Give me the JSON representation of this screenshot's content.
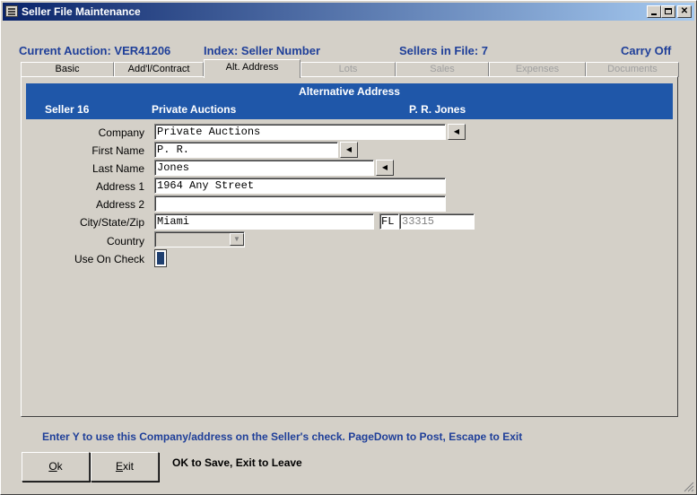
{
  "window": {
    "title": "Seller File Maintenance"
  },
  "infobar": {
    "current_auction": "Current Auction: VER41206",
    "index": "Index: Seller Number",
    "sellers_in_file": "Sellers in File: 7",
    "carry": "Carry Off"
  },
  "tabs": [
    {
      "label": "Basic",
      "state": "normal"
    },
    {
      "label": "Add'l/Contract",
      "state": "normal"
    },
    {
      "label": "Alt. Address",
      "state": "active"
    },
    {
      "label": "Lots",
      "state": "disabled"
    },
    {
      "label": "Sales",
      "state": "disabled"
    },
    {
      "label": "Expenses",
      "state": "disabled"
    },
    {
      "label": "Documents",
      "state": "disabled"
    }
  ],
  "banner": {
    "heading": "Alternative Address",
    "seller": "Seller 16",
    "company": "Private Auctions",
    "name": "P. R. Jones"
  },
  "form": {
    "company_label": "Company",
    "company_value": "Private Auctions",
    "first_name_label": "First Name",
    "first_name_value": "P. R.",
    "last_name_label": "Last Name",
    "last_name_value": "Jones",
    "address1_label": "Address 1",
    "address1_value": "1964 Any Street",
    "address2_label": "Address 2",
    "address2_value": "",
    "city_state_zip_label": "City/State/Zip",
    "city_value": "Miami",
    "state_value": "FL",
    "zip_value": "33315",
    "country_label": "Country",
    "country_value": "",
    "use_on_check_label": "Use On Check"
  },
  "status": {
    "hint": "Enter Y to use this Company/address on the Seller's check.  PageDown to Post, Escape to Exit"
  },
  "buttons": {
    "ok_prefix": "O",
    "ok_rest": "k",
    "exit_prefix": "E",
    "exit_rest": "xit"
  },
  "footer": {
    "message": "OK to Save, Exit to Leave"
  }
}
